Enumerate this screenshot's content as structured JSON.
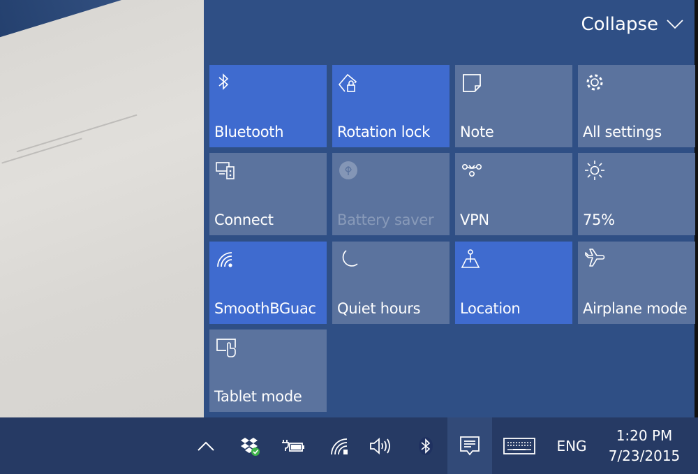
{
  "action_center": {
    "collapse_label": "Collapse",
    "collapse_icon": "chevron-down-icon",
    "tiles": [
      {
        "label": "Bluetooth",
        "icon": "bluetooth-icon",
        "state": "on"
      },
      {
        "label": "Rotation lock",
        "icon": "rotation-lock-icon",
        "state": "on"
      },
      {
        "label": "Note",
        "icon": "note-icon",
        "state": "off"
      },
      {
        "label": "All settings",
        "icon": "gear-icon",
        "state": "off"
      },
      {
        "label": "Connect",
        "icon": "connect-icon",
        "state": "off"
      },
      {
        "label": "Battery saver",
        "icon": "battery-saver-icon",
        "state": "disabled"
      },
      {
        "label": "VPN",
        "icon": "vpn-icon",
        "state": "off"
      },
      {
        "label": "75%",
        "icon": "brightness-icon",
        "state": "off"
      },
      {
        "label": "SmoothBGuac",
        "icon": "wifi-icon",
        "state": "on"
      },
      {
        "label": "Quiet hours",
        "icon": "moon-icon",
        "state": "off"
      },
      {
        "label": "Location",
        "icon": "location-icon",
        "state": "on"
      },
      {
        "label": "Airplane mode",
        "icon": "airplane-icon",
        "state": "off"
      },
      {
        "label": "Tablet mode",
        "icon": "tablet-mode-icon",
        "state": "off"
      }
    ]
  },
  "taskbar": {
    "tray_icons": [
      {
        "name": "show-hidden-icons",
        "icon": "chevron-up-icon"
      },
      {
        "name": "dropbox",
        "icon": "dropbox-synced-icon"
      },
      {
        "name": "power",
        "icon": "battery-charging-icon"
      },
      {
        "name": "network",
        "icon": "wifi-icon"
      },
      {
        "name": "volume",
        "icon": "speaker-icon"
      },
      {
        "name": "bluetooth",
        "icon": "bluetooth-icon"
      },
      {
        "name": "action-center",
        "icon": "action-center-icon"
      },
      {
        "name": "touch-keyboard",
        "icon": "keyboard-icon"
      }
    ],
    "language": "ENG",
    "time": "1:20 PM",
    "date": "7/23/2015"
  },
  "colors": {
    "tile_on": "#3f6bcf",
    "tile_off": "#5b739e",
    "panel": "#2f4f85",
    "taskbar": "#263a64"
  }
}
